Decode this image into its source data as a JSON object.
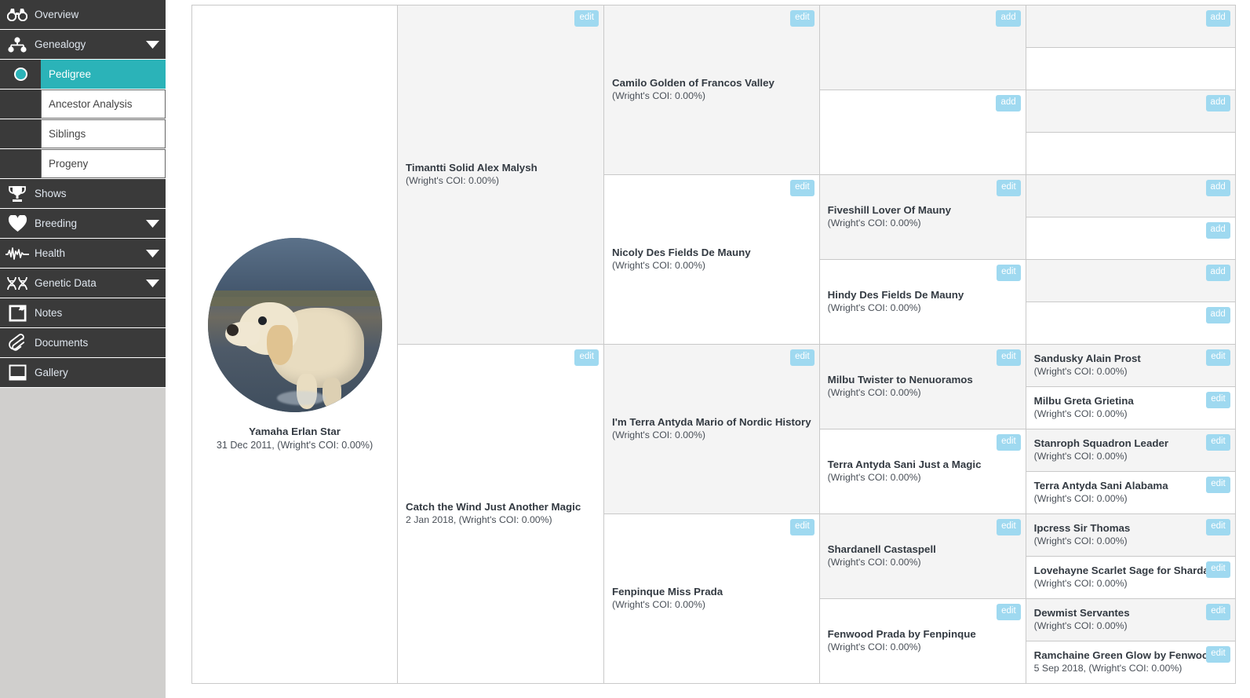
{
  "sidebar": {
    "items": [
      {
        "label": "Overview",
        "icon": "binoculars-icon",
        "caret": false,
        "key": "overview"
      },
      {
        "label": "Genealogy",
        "icon": "sitemap-icon",
        "caret": true,
        "key": "genealogy"
      }
    ],
    "sub_items": [
      {
        "label": "Pedigree",
        "active": true,
        "key": "pedigree"
      },
      {
        "label": "Ancestor Analysis",
        "active": false,
        "key": "ancestor-analysis"
      },
      {
        "label": "Siblings",
        "active": false,
        "key": "siblings"
      },
      {
        "label": "Progeny",
        "active": false,
        "key": "progeny"
      }
    ],
    "items_lower": [
      {
        "label": "Shows",
        "icon": "trophy-icon",
        "caret": false,
        "key": "shows"
      },
      {
        "label": "Breeding",
        "icon": "heart-icon",
        "caret": true,
        "key": "breeding"
      },
      {
        "label": "Health",
        "icon": "heartbeat-icon",
        "caret": true,
        "key": "health"
      },
      {
        "label": "Genetic Data",
        "icon": "dna-icon",
        "caret": true,
        "key": "genetic-data"
      },
      {
        "label": "Notes",
        "icon": "sticky-note-icon",
        "caret": false,
        "key": "notes"
      },
      {
        "label": "Documents",
        "icon": "paperclip-icon",
        "caret": false,
        "key": "documents"
      },
      {
        "label": "Gallery",
        "icon": "image-icon",
        "caret": false,
        "key": "gallery"
      }
    ],
    "colors": {
      "nav_background": "#3a3a3a",
      "nav_text": "#dfe6ee",
      "active_highlight": "#2bb3b8",
      "panel_background": "#d0cfcd"
    }
  },
  "badges": {
    "edit": "edit",
    "add": "add"
  },
  "accent_badge_color": "#9fd9f0",
  "subject": {
    "name": "Yamaha Erlan Star",
    "meta": "31 Dec 2011, (Wright's COI: 0.00%)",
    "avatar_alt": "golden-retriever-puppy-in-water"
  },
  "generation_2": [
    {
      "name": "Timantti Solid Alex Malysh",
      "meta": "(Wright's COI: 0.00%)",
      "badge": "edit",
      "shaded": true
    },
    {
      "name": "Catch the Wind Just Another Magic",
      "meta": "2 Jan 2018, (Wright's COI: 0.00%)",
      "badge": "edit",
      "shaded": false
    }
  ],
  "generation_3": [
    {
      "name": "Camilo Golden of Francos Valley",
      "meta": "(Wright's COI: 0.00%)",
      "badge": "edit",
      "shaded": true
    },
    {
      "name": "Nicoly Des Fields De Mauny",
      "meta": "(Wright's COI: 0.00%)",
      "badge": "edit",
      "shaded": false
    },
    {
      "name": "I'm Terra Antyda Mario of Nordic History",
      "meta": "(Wright's COI: 0.00%)",
      "badge": "edit",
      "shaded": true
    },
    {
      "name": "Fenpinque Miss Prada",
      "meta": "(Wright's COI: 0.00%)",
      "badge": "edit",
      "shaded": false
    }
  ],
  "generation_4": [
    {
      "name": "",
      "meta": "",
      "badge": "add",
      "shaded": true
    },
    {
      "name": "",
      "meta": "",
      "badge": "add",
      "shaded": false
    },
    {
      "name": "Fiveshill Lover Of Mauny",
      "meta": "(Wright's COI: 0.00%)",
      "badge": "edit",
      "shaded": true
    },
    {
      "name": "Hindy Des Fields De Mauny",
      "meta": "(Wright's COI: 0.00%)",
      "badge": "edit",
      "shaded": false
    },
    {
      "name": "Milbu Twister to Nenuoramos",
      "meta": "(Wright's COI: 0.00%)",
      "badge": "edit",
      "shaded": true
    },
    {
      "name": "Terra Antyda Sani Just a Magic",
      "meta": "(Wright's COI: 0.00%)",
      "badge": "edit",
      "shaded": false
    },
    {
      "name": "Shardanell Castaspell",
      "meta": "(Wright's COI: 0.00%)",
      "badge": "edit",
      "shaded": true
    },
    {
      "name": "Fenwood Prada by Fenpinque",
      "meta": "(Wright's COI: 0.00%)",
      "badge": "edit",
      "shaded": false
    }
  ],
  "generation_5": [
    {
      "name": "",
      "meta": "",
      "badge": "add",
      "shaded": true
    },
    {
      "name": "",
      "meta": "",
      "badge": "",
      "shaded": false
    },
    {
      "name": "",
      "meta": "",
      "badge": "add",
      "shaded": true
    },
    {
      "name": "",
      "meta": "",
      "badge": "",
      "shaded": false
    },
    {
      "name": "",
      "meta": "",
      "badge": "add",
      "shaded": true
    },
    {
      "name": "",
      "meta": "",
      "badge": "add",
      "shaded": false
    },
    {
      "name": "",
      "meta": "",
      "badge": "add",
      "shaded": true
    },
    {
      "name": "",
      "meta": "",
      "badge": "add",
      "shaded": false
    },
    {
      "name": "Sandusky Alain Prost",
      "meta": "(Wright's COI: 0.00%)",
      "badge": "edit",
      "shaded": true
    },
    {
      "name": "Milbu Greta Grietina",
      "meta": "(Wright's COI: 0.00%)",
      "badge": "edit",
      "shaded": false
    },
    {
      "name": "Stanroph Squadron Leader",
      "meta": "(Wright's COI: 0.00%)",
      "badge": "edit",
      "shaded": true
    },
    {
      "name": "Terra Antyda Sani Alabama",
      "meta": "(Wright's COI: 0.00%)",
      "badge": "edit",
      "shaded": false
    },
    {
      "name": "Ipcress Sir Thomas",
      "meta": "(Wright's COI: 0.00%)",
      "badge": "edit",
      "shaded": true
    },
    {
      "name": "Lovehayne Scarlet Sage for Shardanell",
      "meta": "(Wright's COI: 0.00%)",
      "badge": "edit",
      "shaded": false
    },
    {
      "name": "Dewmist Servantes",
      "meta": "(Wright's COI: 0.00%)",
      "badge": "edit",
      "shaded": true
    },
    {
      "name": "Ramchaine Green Glow by Fenwood",
      "meta": "5 Sep 2018, (Wright's COI: 0.00%)",
      "badge": "edit",
      "shaded": false
    }
  ]
}
